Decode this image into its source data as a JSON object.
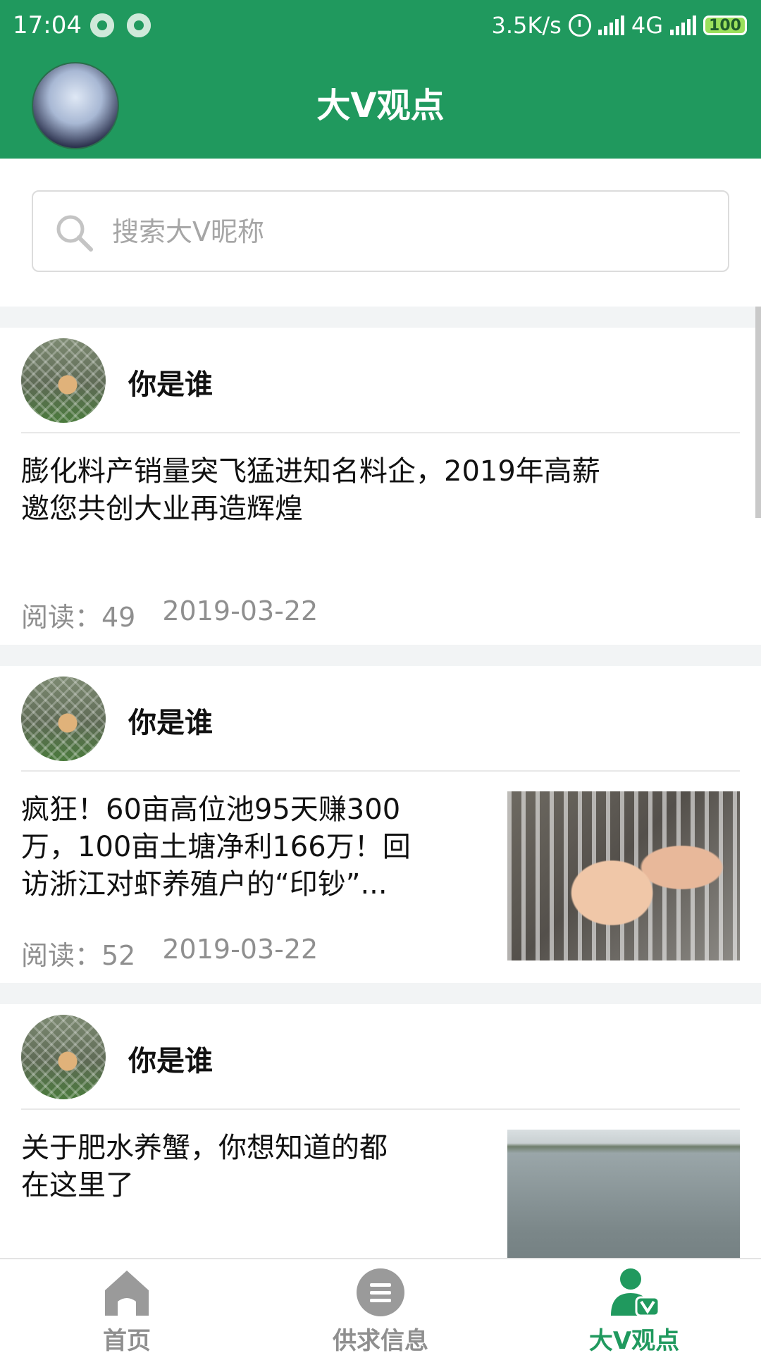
{
  "status_bar": {
    "time": "17:04",
    "network_speed": "3.5K/s",
    "network_type": "4G",
    "battery": "100"
  },
  "header": {
    "title": "大V观点"
  },
  "search": {
    "placeholder": "搜索大V昵称"
  },
  "feed": {
    "items": [
      {
        "author": "你是谁",
        "title": "膨化料产销量突飞猛进知名料企，2019年高薪邀您共创大业再造辉煌",
        "title_lines": [
          "膨化料产销量突飞猛进知名料企，2019年高薪",
          "邀您共创大业再造辉煌"
        ],
        "reads_label": "阅读：49",
        "date": "2019-03-22",
        "thumbnail": null
      },
      {
        "author": "你是谁",
        "title": "疯狂！60亩高位池95天赚300万，100亩土塘净利166万！回访浙江对虾养殖户的“印钞”...",
        "title_lines": [
          "疯狂！60亩高位池95天赚300",
          "万，100亩土塘净利166万！回",
          "访浙江对虾养殖户的“印钞”..."
        ],
        "reads_label": "阅读：52",
        "date": "2019-03-22",
        "thumbnail": "shrimp-photo"
      },
      {
        "author": "你是谁",
        "title": "关于肥水养蟹，你想知道的都在这里了",
        "title_lines": [
          "关于肥水养蟹，你想知道的都",
          "在这里了"
        ],
        "reads_label": "",
        "date": "",
        "thumbnail": "pond-photo"
      }
    ]
  },
  "bottom_nav": {
    "items": [
      {
        "label": "首页",
        "icon": "home-icon",
        "active": false
      },
      {
        "label": "供求信息",
        "icon": "message-icon",
        "active": false
      },
      {
        "label": "大V观点",
        "icon": "user-v-icon",
        "active": true
      }
    ]
  },
  "colors": {
    "brand_green": "#20995e",
    "inactive_gray": "#8f8f8f"
  }
}
